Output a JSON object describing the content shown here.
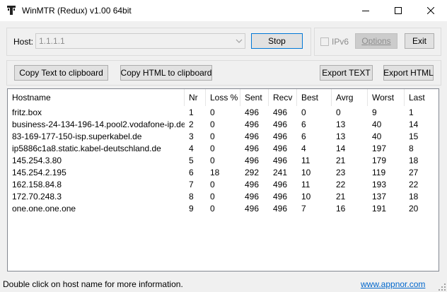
{
  "window": {
    "title": "WinMTR (Redux) v1.00 64bit"
  },
  "host": {
    "label": "Host:",
    "value": "1.1.1.1"
  },
  "buttons": {
    "stop": "Stop",
    "ipv6": "IPv6",
    "options": "Options",
    "exit": "Exit",
    "copy_text": "Copy Text to clipboard",
    "copy_html": "Copy HTML to clipboard",
    "export_text": "Export TEXT",
    "export_html": "Export HTML"
  },
  "table": {
    "columns": [
      "Hostname",
      "Nr",
      "Loss %",
      "Sent",
      "Recv",
      "Best",
      "Avrg",
      "Worst",
      "Last"
    ],
    "rows": [
      [
        "fritz.box",
        "1",
        "0",
        "496",
        "496",
        "0",
        "0",
        "9",
        "1"
      ],
      [
        "business-24-134-196-14.pool2.vodafone-ip.de",
        "2",
        "0",
        "496",
        "496",
        "6",
        "13",
        "40",
        "14"
      ],
      [
        "83-169-177-150-isp.superkabel.de",
        "3",
        "0",
        "496",
        "496",
        "6",
        "13",
        "40",
        "15"
      ],
      [
        "ip5886c1a8.static.kabel-deutschland.de",
        "4",
        "0",
        "496",
        "496",
        "4",
        "14",
        "197",
        "8"
      ],
      [
        "145.254.3.80",
        "5",
        "0",
        "496",
        "496",
        "11",
        "21",
        "179",
        "18"
      ],
      [
        "145.254.2.195",
        "6",
        "18",
        "292",
        "241",
        "10",
        "23",
        "119",
        "27"
      ],
      [
        "162.158.84.8",
        "7",
        "0",
        "496",
        "496",
        "11",
        "22",
        "193",
        "22"
      ],
      [
        "172.70.248.3",
        "8",
        "0",
        "496",
        "496",
        "10",
        "21",
        "137",
        "18"
      ],
      [
        "one.one.one.one",
        "9",
        "0",
        "496",
        "496",
        "7",
        "16",
        "191",
        "20"
      ]
    ]
  },
  "status": {
    "message": "Double click on host name for more information.",
    "link": "www.appnor.com"
  }
}
